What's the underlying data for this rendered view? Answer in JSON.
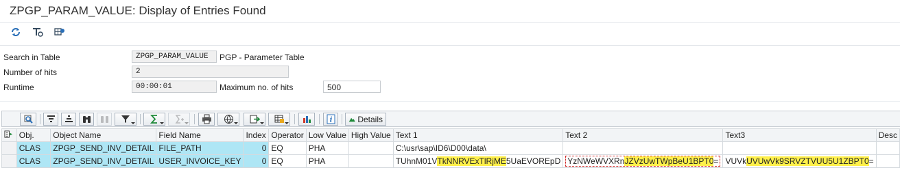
{
  "window": {
    "title": "ZPGP_PARAM_VALUE: Display of Entries Found"
  },
  "app_toolbar": {
    "icons": [
      "refresh-icon",
      "table-settings-icon",
      "grid-settings-icon"
    ]
  },
  "selection": {
    "search_label": "Search in Table",
    "table_name": "ZPGP_PARAM_VALUE",
    "table_desc": "PGP - Parameter Table",
    "hits_label": "Number of hits",
    "hits_value": "2",
    "runtime_label": "Runtime",
    "runtime_value": "00:00:01",
    "maxhits_label": "Maximum no. of hits",
    "maxhits_value": "500"
  },
  "alv_toolbar": {
    "details_label": "Details"
  },
  "grid": {
    "columns": [
      "Obj.",
      "Object Name",
      "Field Name",
      "Index",
      "Operator",
      "Low Value",
      "High Value",
      "Text 1",
      "Text 2",
      "Text3",
      "Desc"
    ],
    "rows": [
      {
        "obj": "CLAS",
        "object_name": "ZPGP_SEND_INV_DETAIL",
        "field_name": "FILE_PATH",
        "index": "0",
        "operator": "EQ",
        "low": "PHA",
        "high": "",
        "text1": "C:\\usr\\sap\\ID6\\D00\\data\\",
        "text2": "",
        "text3": "",
        "desc": ""
      },
      {
        "obj": "CLAS",
        "object_name": "ZPGP_SEND_INV_DETAIL",
        "field_name": "USER_INVOICE_KEY",
        "index": "0",
        "operator": "EQ",
        "low": "PHA",
        "high": "",
        "text1_a": "TUhnM01V",
        "text1_b": "TkNNRVExTlRjME",
        "text1_c": "5UaEVOREpD",
        "text2_a": "YzNWeWVXRn",
        "text2_b": "JZVzUwTWpBeU1BPT0",
        "text2_c": "=",
        "text3_a": "VUVk",
        "text3_b": "UVUwVk9SRVZTVUU5U1ZBPT0",
        "text3_c": "=",
        "desc": ""
      }
    ]
  },
  "colors": {
    "key_cell": "#aee6f5",
    "highlight": "#fff04a",
    "mark_border": "#d02a2a"
  }
}
